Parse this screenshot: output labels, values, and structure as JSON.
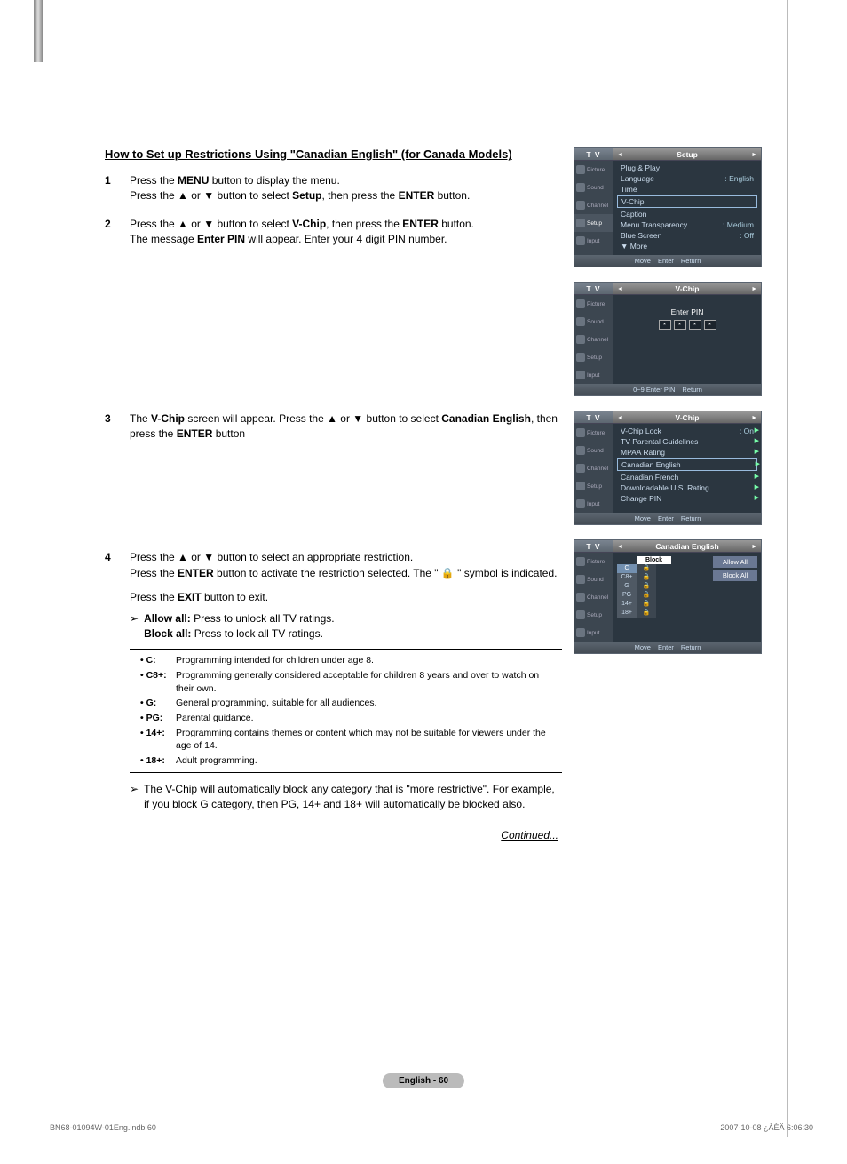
{
  "heading": "How to Set up Restrictions Using \"Canadian English\" (for Canada Models)",
  "steps": {
    "s1": {
      "num": "1",
      "line1_a": "Press the ",
      "line1_b": "MENU",
      "line1_c": " button to display the menu.",
      "line2_a": "Press the ▲ or ▼ button to select ",
      "line2_b": "Setup",
      "line2_c": ", then press the ",
      "line2_d": "ENTER",
      "line2_e": " button."
    },
    "s2": {
      "num": "2",
      "line1_a": "Press the ▲ or ▼ button to select ",
      "line1_b": "V-Chip",
      "line1_c": ", then press the ",
      "line1_d": "ENTER",
      "line1_e": " button.",
      "line2_a": "The message ",
      "line2_b": "Enter PIN",
      "line2_c": " will appear. Enter your 4 digit PIN number."
    },
    "s3": {
      "num": "3",
      "line1_a": "The ",
      "line1_b": "V-Chip",
      "line1_c": " screen will appear. Press the ▲ or ▼ button to select ",
      "line1_d": "Canadian English",
      "line1_e": ", then press the ",
      "line1_f": "ENTER",
      "line1_g": " button"
    },
    "s4": {
      "num": "4",
      "line1": "Press the ▲ or ▼ button to select an appropriate restriction.",
      "line2_a": "Press the ",
      "line2_b": "ENTER",
      "line2_c": " button to activate the restriction selected. The \" 🔒 \" symbol is indicated.",
      "line3_a": "Press the ",
      "line3_b": "EXIT",
      "line3_c": " button to exit.",
      "allow_lbl": "Allow all:",
      "allow_txt": " Press to unlock all TV ratings.",
      "block_lbl": "Block all:",
      "block_txt": " Press to lock all TV ratings."
    }
  },
  "defs": [
    {
      "k": "• C:",
      "v": "Programming intended for children under age 8."
    },
    {
      "k": "• C8+:",
      "v": "Programming generally considered acceptable for children 8 years and over to watch on their own."
    },
    {
      "k": "• G:",
      "v": "General programming, suitable for all audiences."
    },
    {
      "k": "• PG:",
      "v": "Parental guidance."
    },
    {
      "k": "• 14+:",
      "v": "Programming contains themes or content which may not be suitable for viewers under the age of 14."
    },
    {
      "k": "• 18+:",
      "v": "Adult programming."
    }
  ],
  "note": "The V-Chip will automatically block any category that is \"more restrictive\". For example, if you block G category, then PG, 14+ and 18+ will automatically be blocked also.",
  "continued": "Continued...",
  "osd": {
    "tvlabel": "T V",
    "side": [
      "Picture",
      "Sound",
      "Channel",
      "Setup",
      "Input"
    ],
    "panel1": {
      "title": "Setup",
      "rows": [
        {
          "lbl": "Plug & Play",
          "val": ""
        },
        {
          "lbl": "Language",
          "val": ": English"
        },
        {
          "lbl": "Time",
          "val": ""
        },
        {
          "lbl": "V-Chip",
          "val": "",
          "outlined": true
        },
        {
          "lbl": "Caption",
          "val": ""
        },
        {
          "lbl": "Menu Transparency",
          "val": ": Medium"
        },
        {
          "lbl": "Blue Screen",
          "val": ": Off"
        },
        {
          "lbl": "▼ More",
          "val": ""
        }
      ],
      "footer": {
        "a": "Move",
        "b": "Enter",
        "c": "Return"
      }
    },
    "panel2": {
      "title": "V-Chip",
      "pin_lbl": "Enter PIN",
      "pin_vals": [
        "*",
        "*",
        "*",
        "*"
      ],
      "footer": {
        "a": "0~9 Enter PIN",
        "b": "Return"
      }
    },
    "panel3": {
      "title": "V-Chip",
      "rows": [
        {
          "lbl": "V-Chip Lock",
          "val": ": On",
          "chev": true
        },
        {
          "lbl": "TV Parental Guidelines",
          "val": "",
          "chev": true
        },
        {
          "lbl": "MPAA Rating",
          "val": "",
          "chev": true
        },
        {
          "lbl": "Canadian English",
          "val": "",
          "outlined": true,
          "chev": true
        },
        {
          "lbl": "Canadian French",
          "val": "",
          "chev": true
        },
        {
          "lbl": "Downloadable U.S. Rating",
          "val": "",
          "chev": true
        },
        {
          "lbl": "Change PIN",
          "val": "",
          "chev": true
        }
      ],
      "footer": {
        "a": "Move",
        "b": "Enter",
        "c": "Return"
      }
    },
    "panel4": {
      "title": "Canadian English",
      "block_hdr": "Block",
      "ratings": [
        "C",
        "C8+",
        "G",
        "PG",
        "14+",
        "18+"
      ],
      "lock": "🔒",
      "allow": "Allow All",
      "blockall": "Block All",
      "footer": {
        "a": "Move",
        "b": "Enter",
        "c": "Return"
      }
    }
  },
  "page_tag": "English - 60",
  "foot_left": "BN68-01094W-01Eng.indb   60",
  "foot_right": "2007-10-08   ¿ÀÈÄ 6:06:30"
}
